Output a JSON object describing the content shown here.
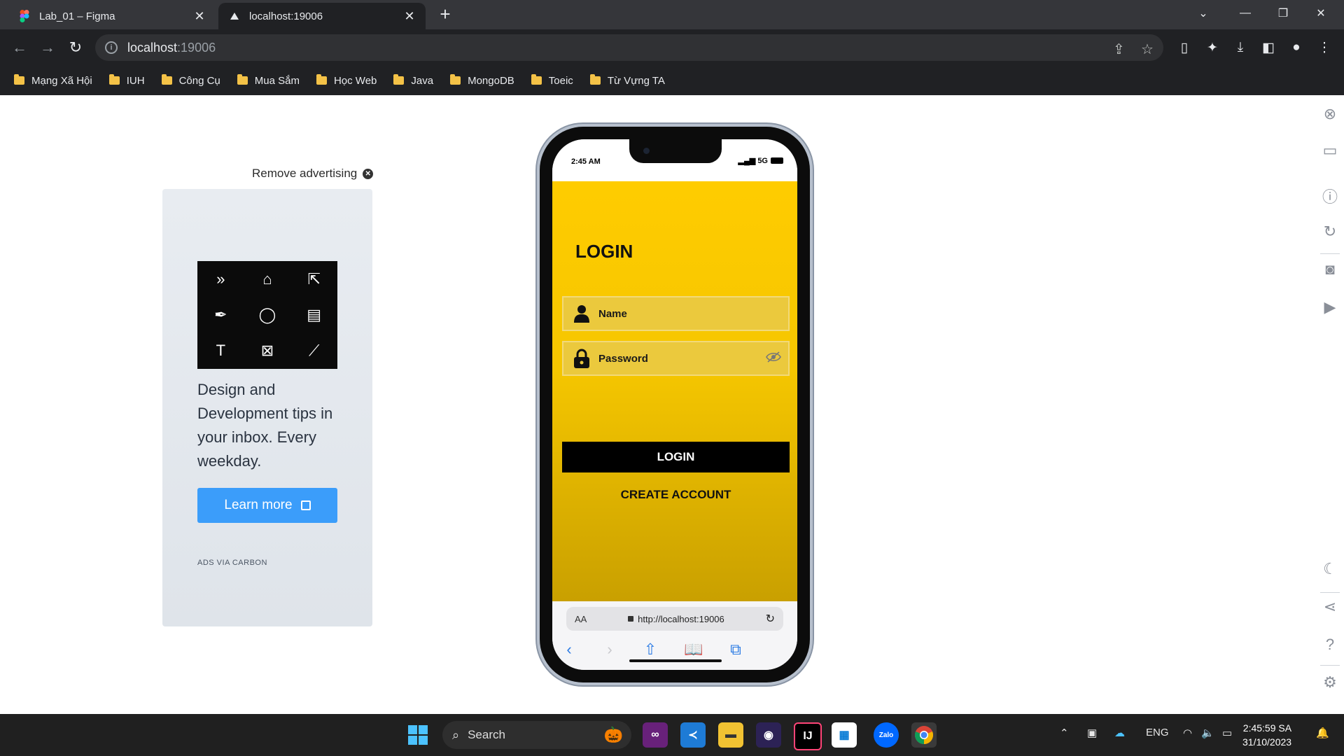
{
  "browser": {
    "tabs": [
      {
        "title": "Lab_01 – Figma",
        "favicon": "figma-icon",
        "active": false
      },
      {
        "title": "localhost:19006",
        "favicon": "expo-icon",
        "active": true
      }
    ],
    "address": {
      "host": "localhost",
      "port": ":19006"
    },
    "bookmarks": [
      "Mạng Xã Hội",
      "IUH",
      "Công Cụ",
      "Mua Sắm",
      "Học Web",
      "Java",
      "MongoDB",
      "Toeic",
      "Từ Vựng TA"
    ]
  },
  "ad": {
    "remove_label": "Remove advertising",
    "headline": "Design and Development tips in your inbox. Every weekday.",
    "button_label": "Learn more",
    "via": "ADS VIA CARBON"
  },
  "phone": {
    "time": "2:45 AM",
    "network": "5G",
    "title": "LOGIN",
    "name_placeholder": "Name",
    "password_placeholder": "Password",
    "login_button": "LOGIN",
    "create_account": "CREATE ACCOUNT",
    "safari_text_size": "AA",
    "safari_url": "http://localhost:19006"
  },
  "taskbar": {
    "search_label": "Search",
    "language": "ENG",
    "time": "2:45:59 SA",
    "date": "31/10/2023"
  },
  "colors": {
    "app_yellow": "#ffcc00",
    "login_button_bg": "#000000",
    "ad_button": "#3b9dfa"
  }
}
